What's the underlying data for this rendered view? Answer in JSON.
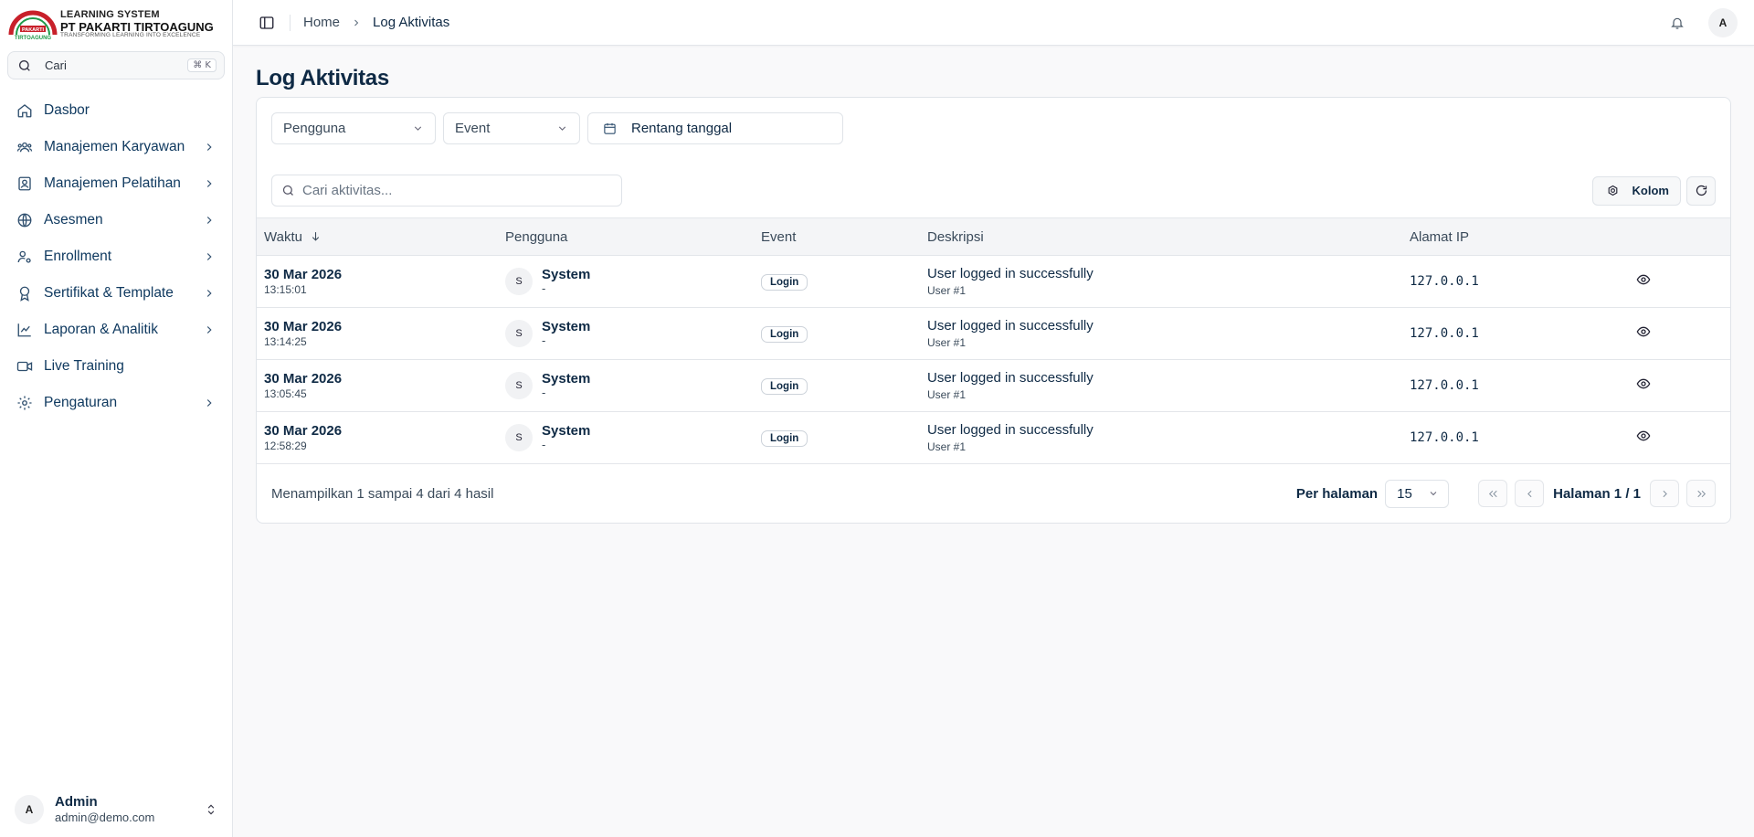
{
  "brand": {
    "line1": "LEARNING SYSTEM",
    "line2": "PT PAKARTI TIRTOAGUNG",
    "line3": "TRANSFORMING LEARNING INTO EXCELENCE",
    "mark_top": "PAKARTI",
    "mark_bottom": "TIRTOAGUNG"
  },
  "sidebar": {
    "search_label": "Cari",
    "search_shortcut": "⌘ K",
    "items": [
      {
        "label": "Dasbor",
        "icon": "home-icon",
        "has_children": false
      },
      {
        "label": "Manajemen Karyawan",
        "icon": "users-icon",
        "has_children": true
      },
      {
        "label": "Manajemen Pelatihan",
        "icon": "training-icon",
        "has_children": true
      },
      {
        "label": "Asesmen",
        "icon": "globe-icon",
        "has_children": true
      },
      {
        "label": "Enrollment",
        "icon": "user-cog-icon",
        "has_children": true
      },
      {
        "label": "Sertifikat & Template",
        "icon": "award-icon",
        "has_children": true
      },
      {
        "label": "Laporan & Analitik",
        "icon": "chart-icon",
        "has_children": true
      },
      {
        "label": "Live Training",
        "icon": "video-icon",
        "has_children": false
      },
      {
        "label": "Pengaturan",
        "icon": "gear-icon",
        "has_children": true
      }
    ],
    "user": {
      "initial": "A",
      "name": "Admin",
      "email": "admin@demo.com"
    }
  },
  "topbar": {
    "breadcrumb": [
      "Home",
      "Log Aktivitas"
    ],
    "avatar_initial": "A"
  },
  "page": {
    "title": "Log Aktivitas",
    "filters": {
      "user": "Pengguna",
      "event": "Event",
      "date_range": "Rentang tanggal"
    },
    "search_placeholder": "Cari aktivitas...",
    "columns_button": "Kolom",
    "table": {
      "headers": [
        "Waktu",
        "Pengguna",
        "Event",
        "Deskripsi",
        "Alamat IP"
      ],
      "rows": [
        {
          "date": "30 Mar 2026",
          "time": "13:15:01",
          "user_initial": "S",
          "user_name": "System",
          "user_sub": "-",
          "event": "Login",
          "desc": "User logged in successfully",
          "desc_sub": "User #1",
          "ip": "127.0.0.1"
        },
        {
          "date": "30 Mar 2026",
          "time": "13:14:25",
          "user_initial": "S",
          "user_name": "System",
          "user_sub": "-",
          "event": "Login",
          "desc": "User logged in successfully",
          "desc_sub": "User #1",
          "ip": "127.0.0.1"
        },
        {
          "date": "30 Mar 2026",
          "time": "13:05:45",
          "user_initial": "S",
          "user_name": "System",
          "user_sub": "-",
          "event": "Login",
          "desc": "User logged in successfully",
          "desc_sub": "User #1",
          "ip": "127.0.0.1"
        },
        {
          "date": "30 Mar 2026",
          "time": "12:58:29",
          "user_initial": "S",
          "user_name": "System",
          "user_sub": "-",
          "event": "Login",
          "desc": "User logged in successfully",
          "desc_sub": "User #1",
          "ip": "127.0.0.1"
        }
      ]
    },
    "pagination": {
      "summary": "Menampilkan 1 sampai 4 dari 4 hasil",
      "per_page_label": "Per halaman",
      "per_page_value": "15",
      "page_info": "Halaman 1 / 1"
    }
  },
  "colors": {
    "primary_text": "#0f2a45",
    "logo_red": "#c8202a",
    "logo_green": "#1f9a4a"
  }
}
